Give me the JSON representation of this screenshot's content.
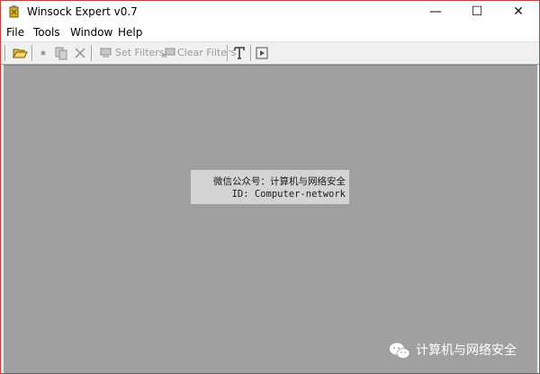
{
  "window": {
    "title": "Winsock Expert v0.7",
    "controls": {
      "minimize": "—",
      "maximize": "☐",
      "close": "✕"
    }
  },
  "menu": [
    "File",
    "Tools",
    "Window",
    "Help"
  ],
  "toolbar": {
    "set_filters": "Set Filters",
    "clear_filters": "Clear Filters"
  },
  "overlay": {
    "line1": "微信公众号：计算机与网络安全",
    "line2": "ID: Computer-network"
  },
  "watermark": {
    "text": "计算机与网络安全"
  },
  "colors": {
    "client_bg": "#a0a0a0",
    "overlay_bg": "#d4d4d4",
    "border": "#c04040"
  }
}
